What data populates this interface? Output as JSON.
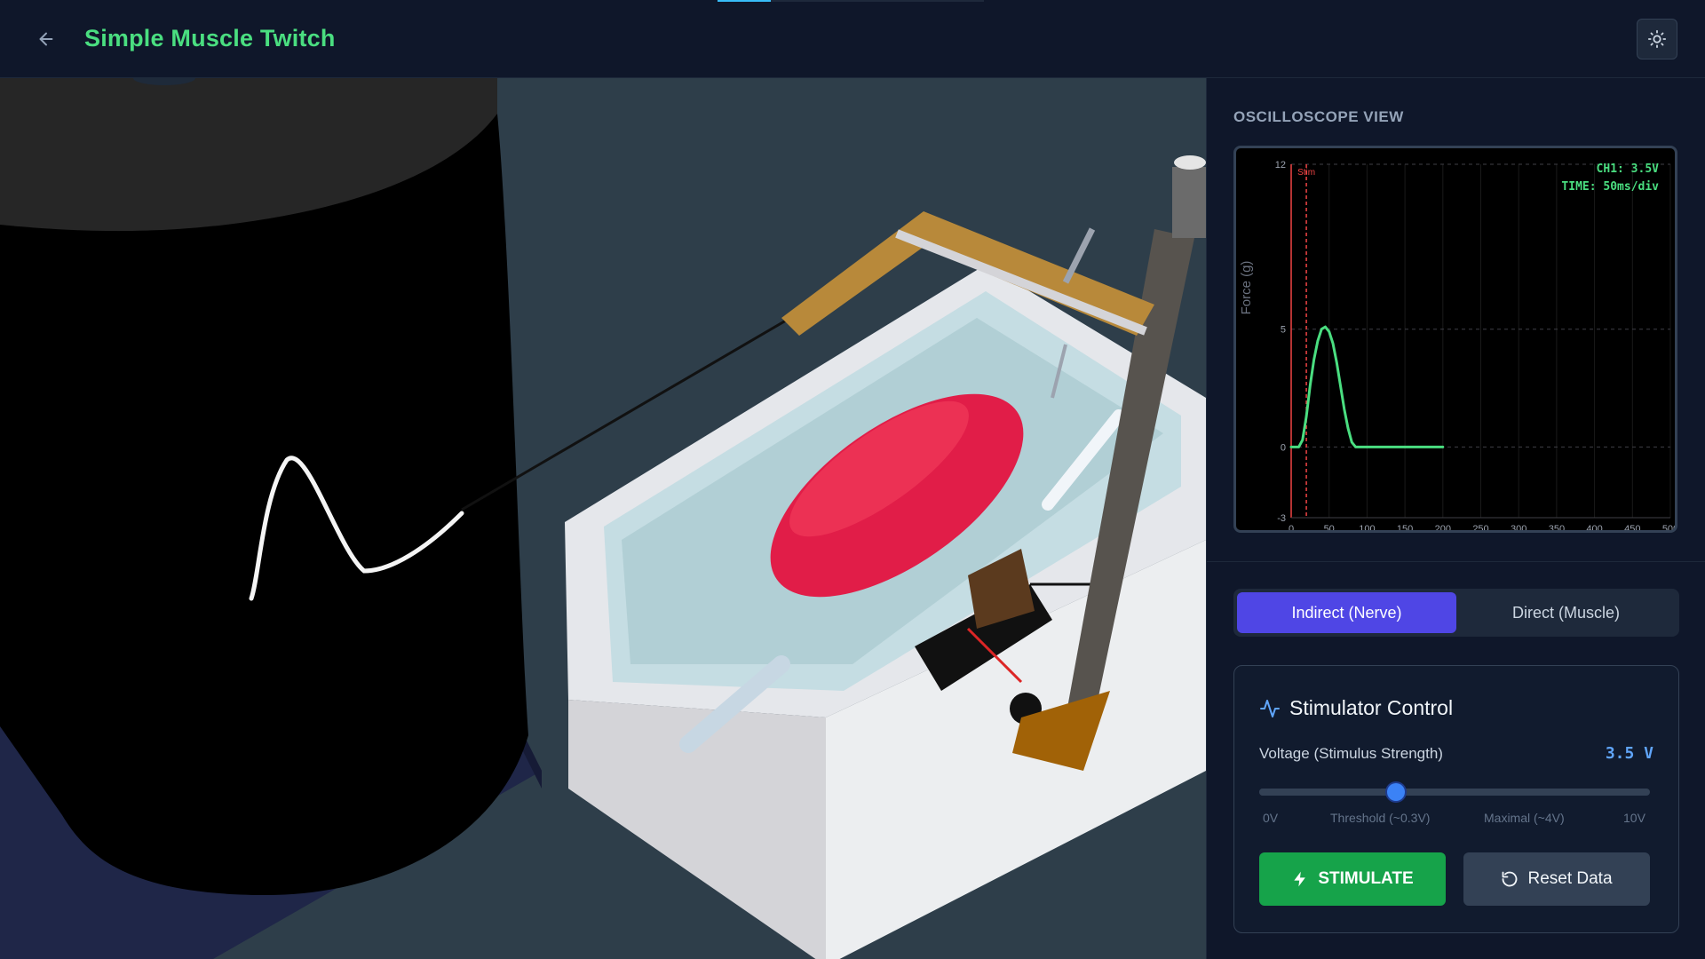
{
  "header": {
    "title": "Simple Muscle Twitch",
    "back_icon": "arrow-left-icon",
    "theme_icon": "sun-icon"
  },
  "oscilloscope": {
    "label": "OSCILLOSCOPE VIEW",
    "channel_readout": "CH1: 3.5V",
    "time_readout": "TIME: 50ms/div",
    "stim_marker_label": "Stim"
  },
  "chart_data": {
    "type": "line",
    "ylabel": "Force (g)",
    "xlabel": "",
    "xlim": [
      0,
      500
    ],
    "ylim": [
      -3,
      12
    ],
    "x_ticks": [
      "0",
      "50",
      "100",
      "150",
      "200",
      "250",
      "300",
      "350",
      "400",
      "450",
      "500"
    ],
    "y_ticks": [
      "12",
      "5",
      "0",
      "-3"
    ],
    "stim_time": 20,
    "series": [
      {
        "color": "#4ade80",
        "x": [
          0,
          10,
          15,
          20,
          25,
          30,
          35,
          40,
          45,
          50,
          55,
          60,
          65,
          70,
          75,
          80,
          85,
          90,
          100,
          120,
          150,
          200
        ],
        "y": [
          0,
          0,
          0.3,
          1.3,
          2.6,
          3.7,
          4.5,
          5.0,
          5.1,
          4.9,
          4.4,
          3.6,
          2.6,
          1.6,
          0.8,
          0.2,
          0,
          0,
          0,
          0,
          0,
          0
        ]
      }
    ]
  },
  "mode": {
    "options": [
      "Indirect (Nerve)",
      "Direct (Muscle)"
    ],
    "selected": "Indirect (Nerve)"
  },
  "stimulator": {
    "title": "Stimulator Control",
    "icon": "activity-icon",
    "voltage_label": "Voltage (Stimulus Strength)",
    "voltage_value": "3.5 V",
    "voltage_fraction": 0.35,
    "ticks": [
      "0V",
      "Threshold (~0.3V)",
      "Maximal (~4V)",
      "10V"
    ],
    "stimulate_label": "STIMULATE",
    "stimulate_icon": "bolt-icon",
    "reset_label": "Reset Data",
    "reset_icon": "rotate-ccw-icon"
  },
  "colors": {
    "title": "#4ade80",
    "accent": "#4f46e5",
    "stimulate": "#16a34a",
    "trace": "#4ade80",
    "stim_marker": "#ef4444",
    "voltage_value": "#60a5fa"
  }
}
